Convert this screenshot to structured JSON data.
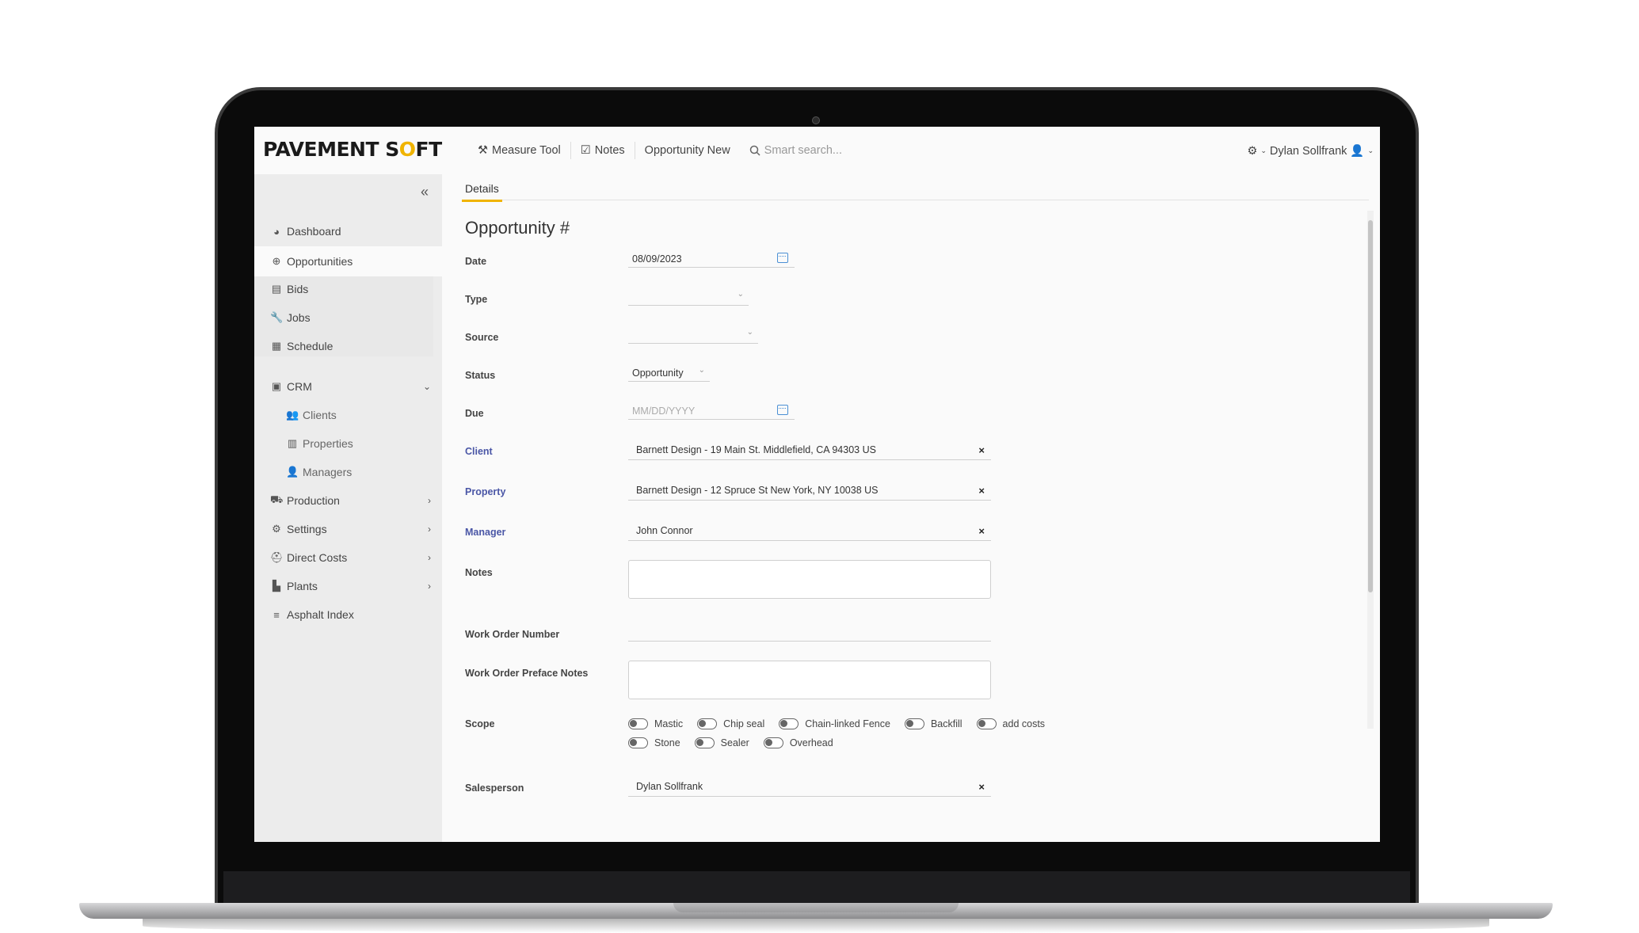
{
  "app": {
    "logo_left": "PAVEMENT S",
    "logo_o": "O",
    "logo_right": "FT"
  },
  "topnav": {
    "measure_tool": "Measure Tool",
    "notes": "Notes",
    "opportunity_new": "Opportunity New",
    "search_placeholder": "Smart search...",
    "user_name": "Dylan Sollfrank"
  },
  "sidebar": {
    "collapse": "«",
    "items": [
      {
        "label": "Dashboard",
        "icon": "dashboard-icon"
      },
      {
        "label": "Opportunities",
        "icon": "plus-circle-icon"
      },
      {
        "label": "Bids",
        "icon": "clipboard-icon"
      },
      {
        "label": "Jobs",
        "icon": "wrench-icon"
      },
      {
        "label": "Schedule",
        "icon": "calendar-icon"
      },
      {
        "label": "CRM",
        "icon": "id-card-icon"
      },
      {
        "label": "Clients",
        "icon": "users-icon"
      },
      {
        "label": "Properties",
        "icon": "building-icon"
      },
      {
        "label": "Managers",
        "icon": "user-icon"
      },
      {
        "label": "Production",
        "icon": "truck-icon"
      },
      {
        "label": "Settings",
        "icon": "gears-icon"
      },
      {
        "label": "Direct Costs",
        "icon": "hardhat-icon"
      },
      {
        "label": "Plants",
        "icon": "industry-icon"
      },
      {
        "label": "Asphalt Index",
        "icon": "layers-icon"
      }
    ]
  },
  "main": {
    "tab": "Details",
    "title": "Opportunity #",
    "fields": {
      "date_label": "Date",
      "date_value": "08/09/2023",
      "type_label": "Type",
      "source_label": "Source",
      "status_label": "Status",
      "status_value": "Opportunity",
      "due_label": "Due",
      "due_placeholder": "MM/DD/YYYY",
      "client_label": "Client",
      "client_value": "Barnett Design - 19 Main St. Middlefield, CA 94303 US",
      "property_label": "Property",
      "property_value": "Barnett Design - 12 Spruce St New York, NY 10038 US",
      "manager_label": "Manager",
      "manager_value": "John Connor",
      "notes_label": "Notes",
      "won_label": "Work Order Number",
      "wopn_label": "Work Order Preface Notes",
      "scope_label": "Scope",
      "salesperson_label": "Salesperson",
      "salesperson_value": "Dylan Sollfrank",
      "clear": "×"
    },
    "scope_row1": [
      "Mastic",
      "Chip seal",
      "Chain-linked Fence",
      "Backfill",
      "add costs"
    ],
    "scope_row2": [
      "Stone",
      "Sealer",
      "Overhead"
    ]
  }
}
